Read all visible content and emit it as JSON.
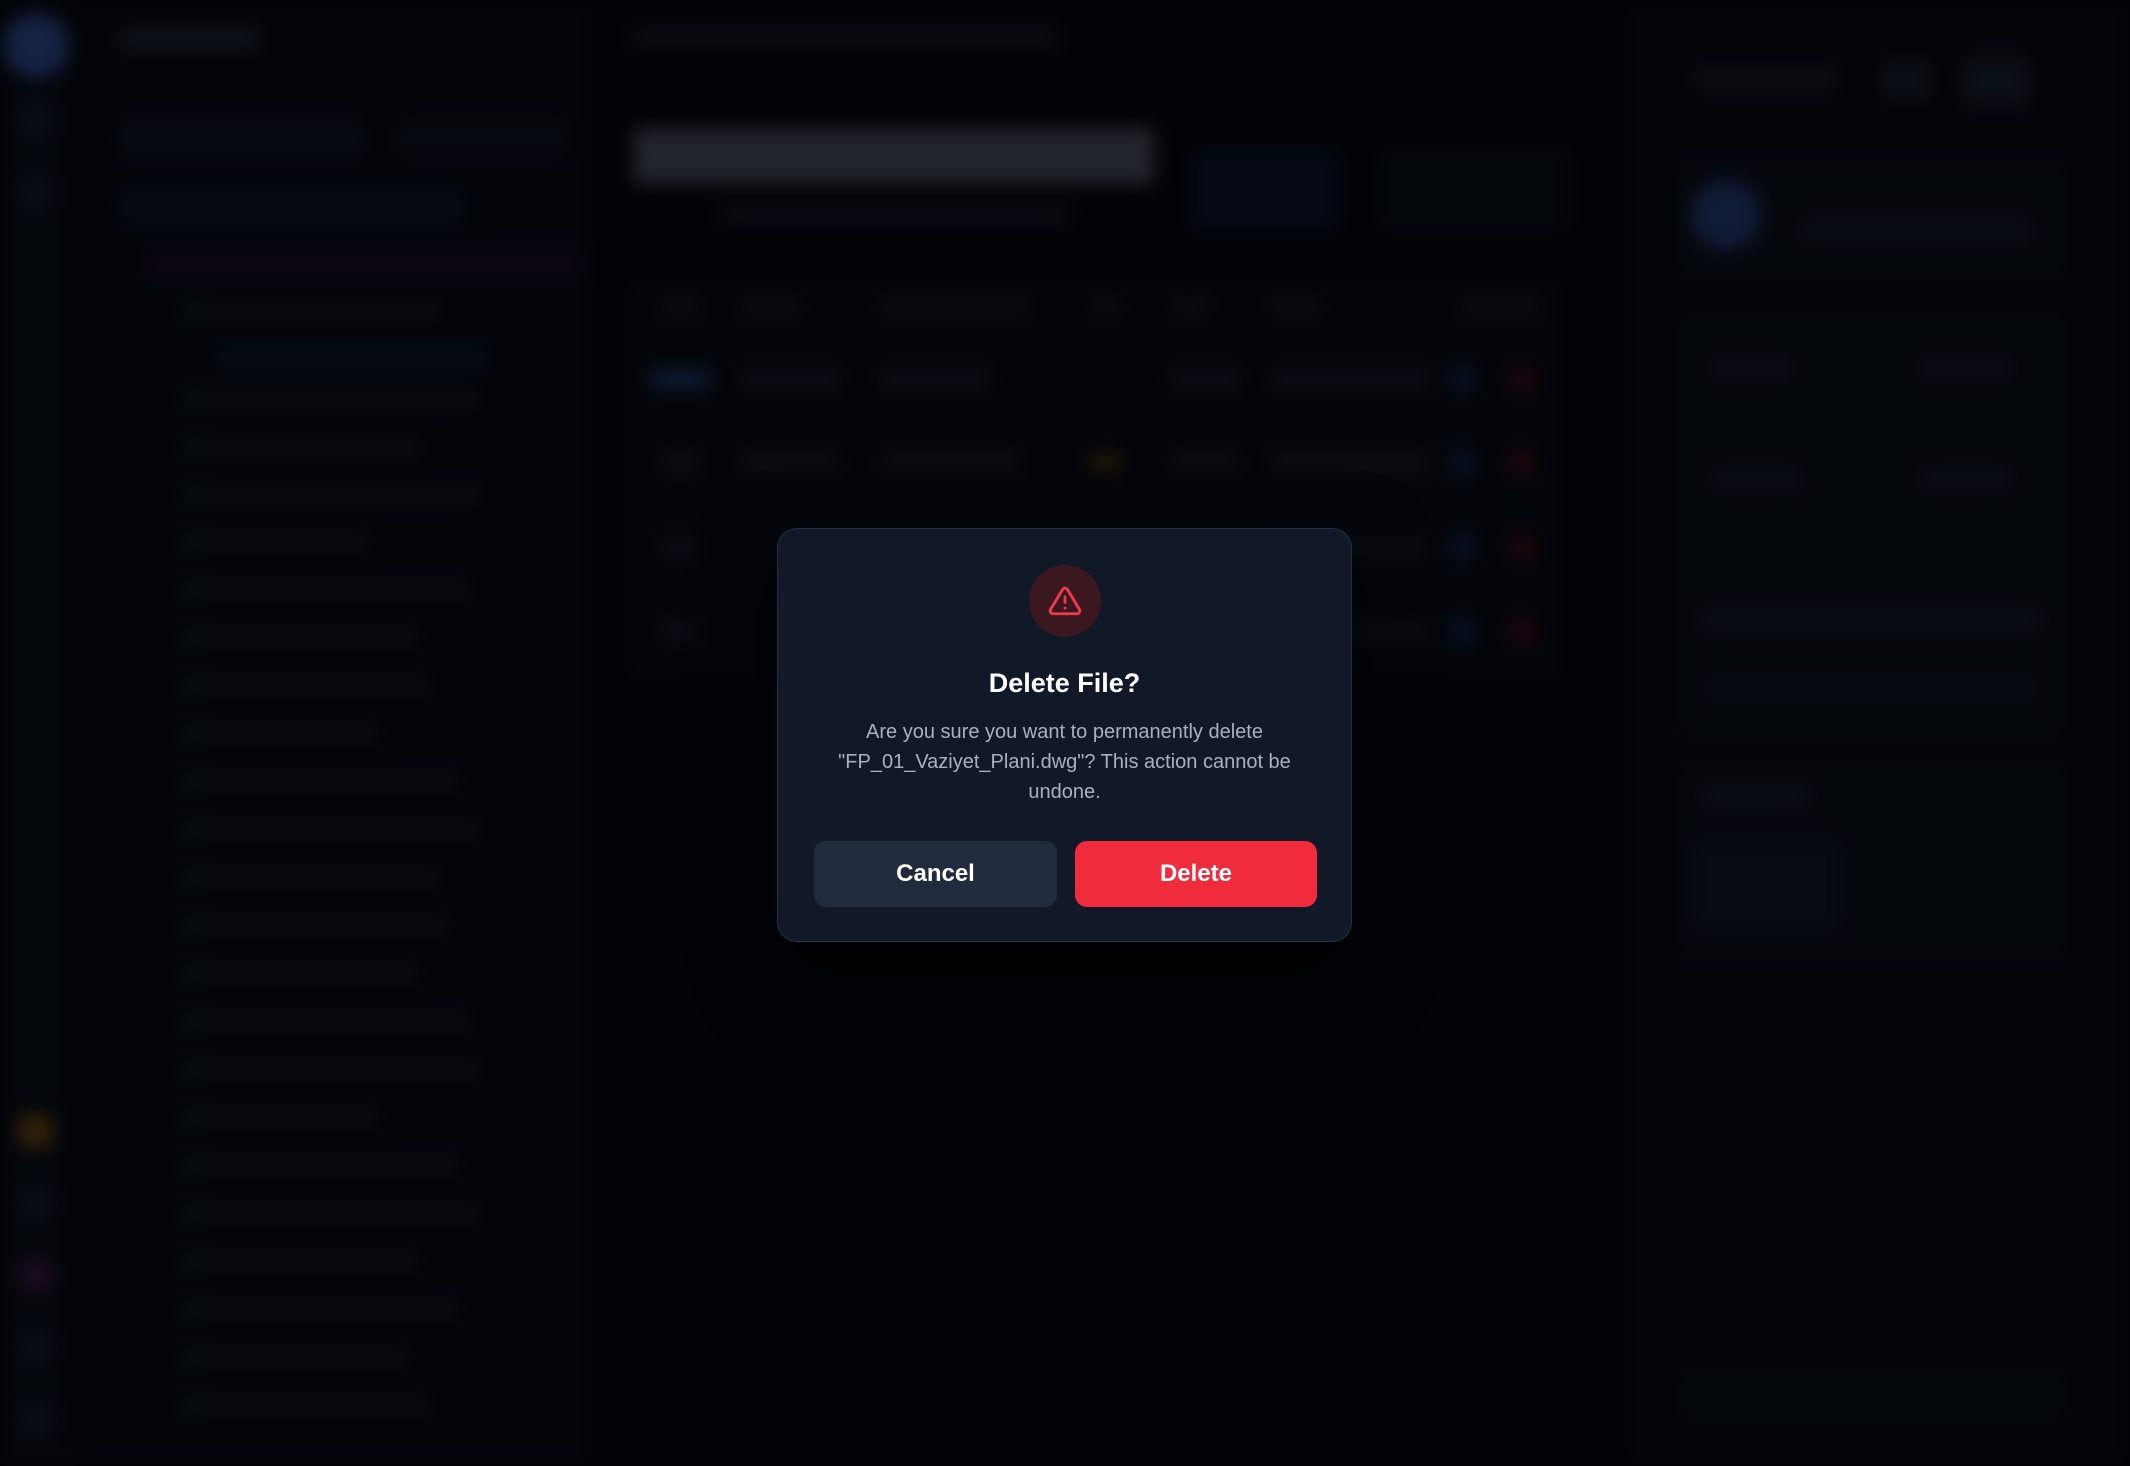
{
  "modal": {
    "title": "Delete File?",
    "message": "Are you sure you want to permanently delete \"FP_01_Vaziyet_Plani.dwg\"? This action cannot be undone.",
    "cancel_label": "Cancel",
    "delete_label": "Delete",
    "icon": "warning-triangle-icon"
  },
  "colors": {
    "danger": "#f02b3c",
    "modal_bg": "#111827",
    "cancel_bg": "#222b3d",
    "icon_bg": "#3b1820"
  }
}
